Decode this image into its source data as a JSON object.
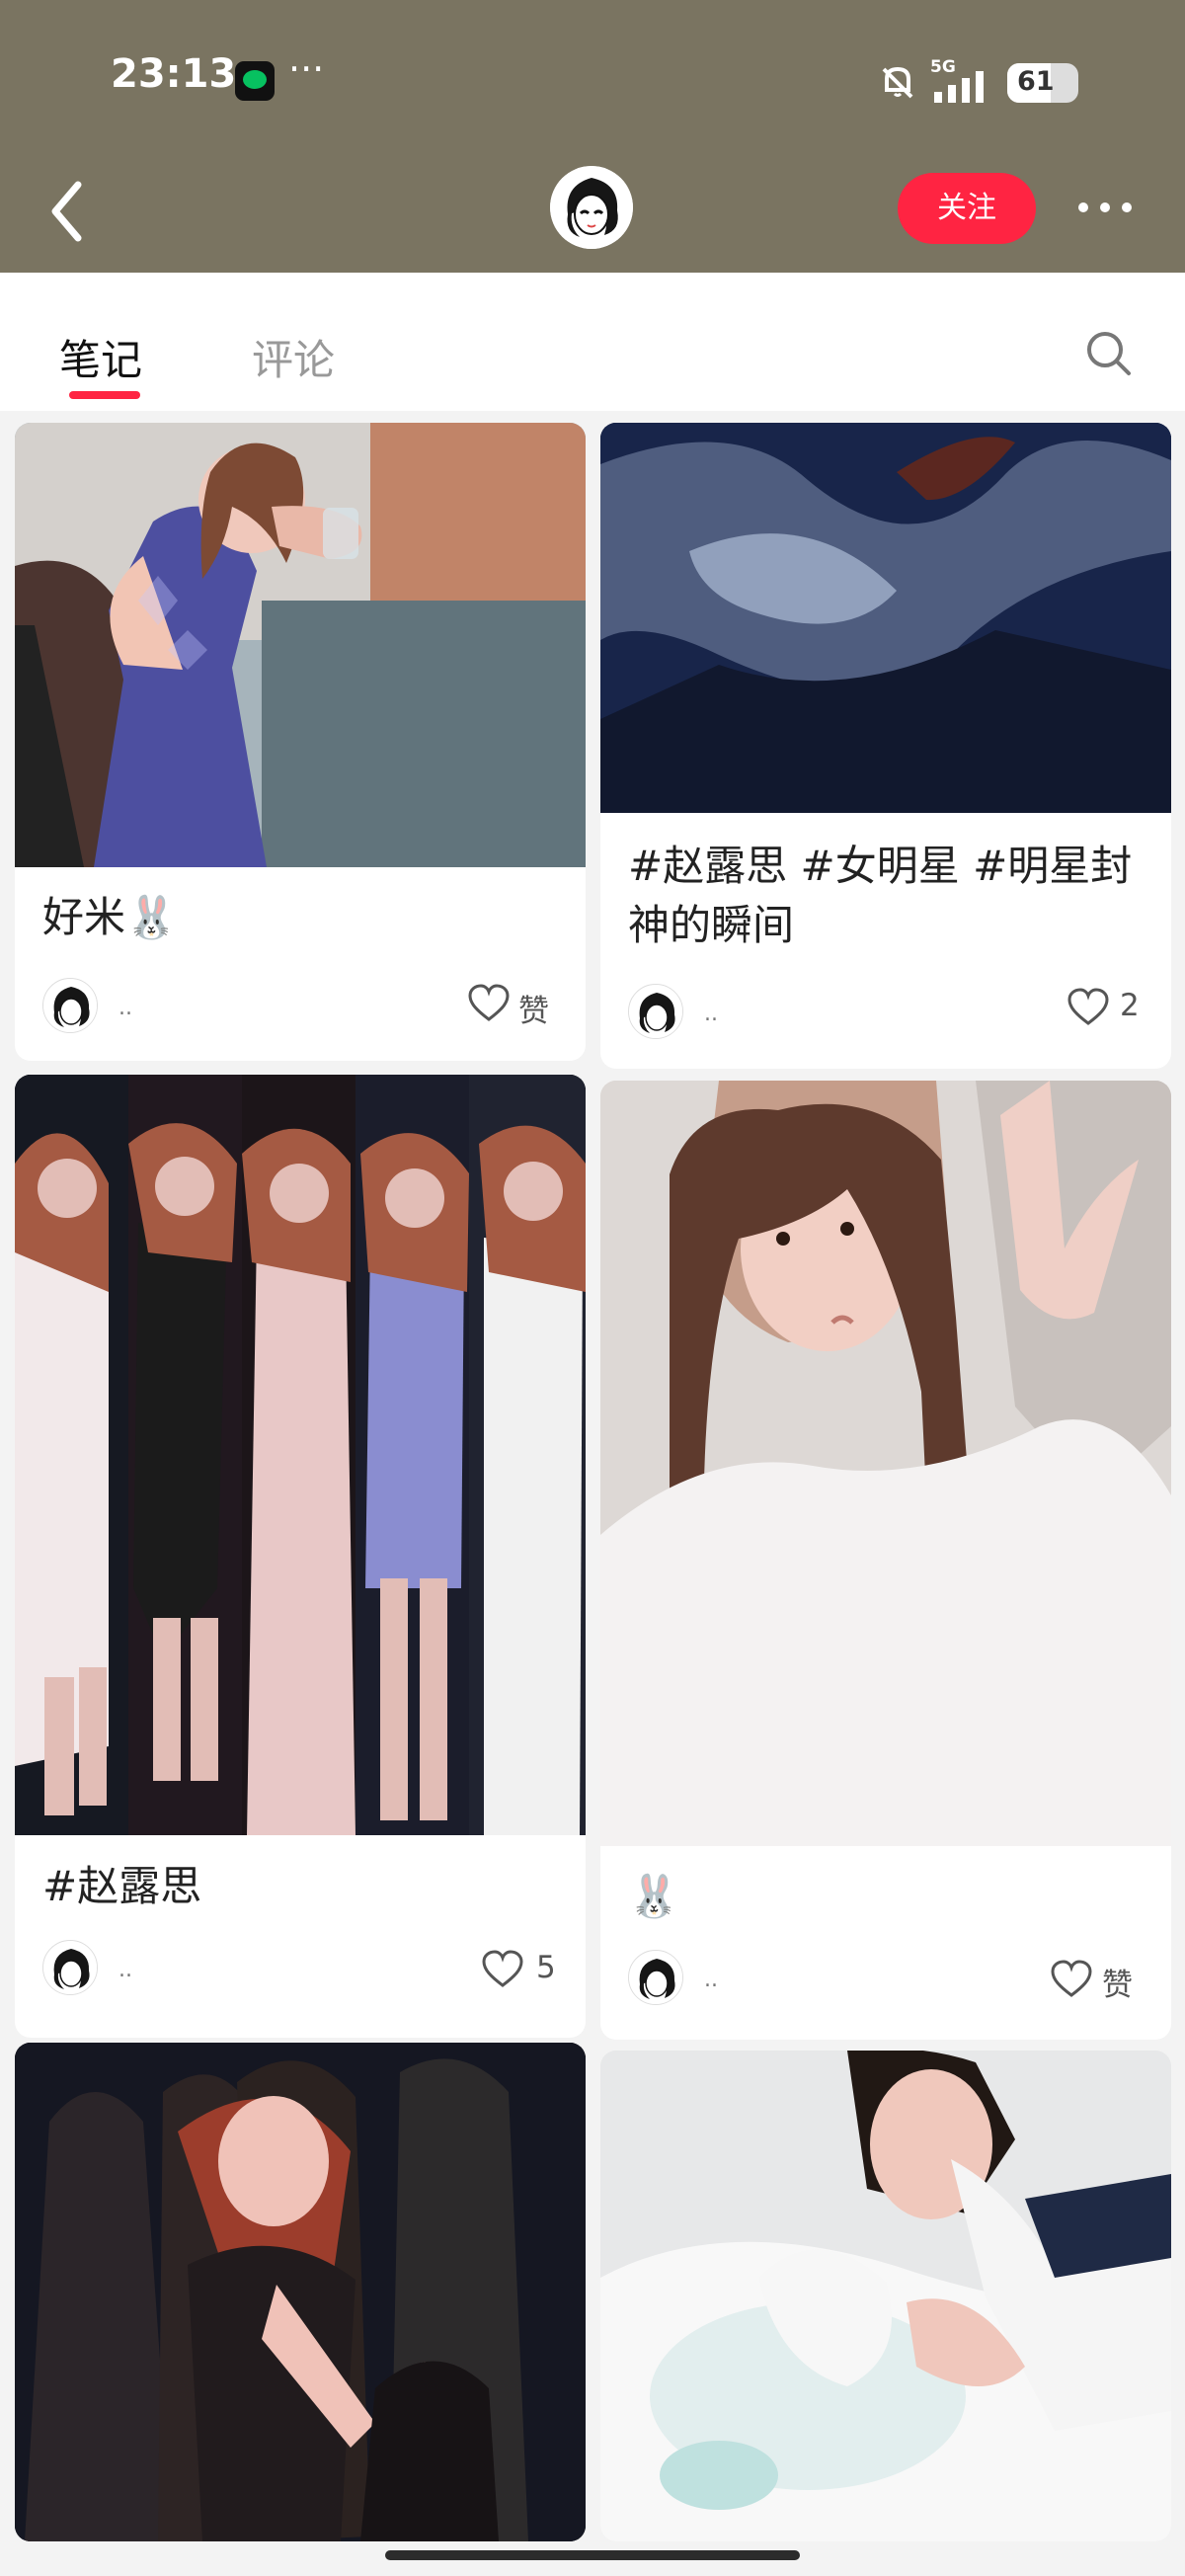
{
  "status_bar": {
    "time": "23:13",
    "overflow": "···",
    "network": "5G",
    "battery": "61",
    "battery_level": 0.61
  },
  "nav": {
    "follow_label": "关注"
  },
  "tabs": [
    {
      "label": "笔记",
      "active": true
    },
    {
      "label": "评论",
      "active": false
    }
  ],
  "icons": {
    "back": "back-arrow-icon",
    "more": "more-icon",
    "search": "search-icon",
    "like": "heart-icon"
  },
  "colors": {
    "header_bg": "#7a7461",
    "accent": "#ff2442"
  },
  "cards": [
    {
      "title_line1": "好米🐰",
      "title_line2": "",
      "author": "..",
      "likes": "赞"
    },
    {
      "title_line1": "#赵露思 #女明星 #明星封",
      "title_line2": "神的瞬间",
      "author": "..",
      "likes": "2"
    },
    {
      "title_line1": "#赵露思",
      "title_line2": "",
      "author": "..",
      "likes": "5"
    },
    {
      "title_line1": "🐰",
      "title_line2": "",
      "author": "..",
      "likes": "赞"
    },
    {
      "title_line1": "",
      "title_line2": "",
      "author": "",
      "likes": ""
    },
    {
      "title_line1": "",
      "title_line2": "",
      "author": "",
      "likes": ""
    }
  ]
}
